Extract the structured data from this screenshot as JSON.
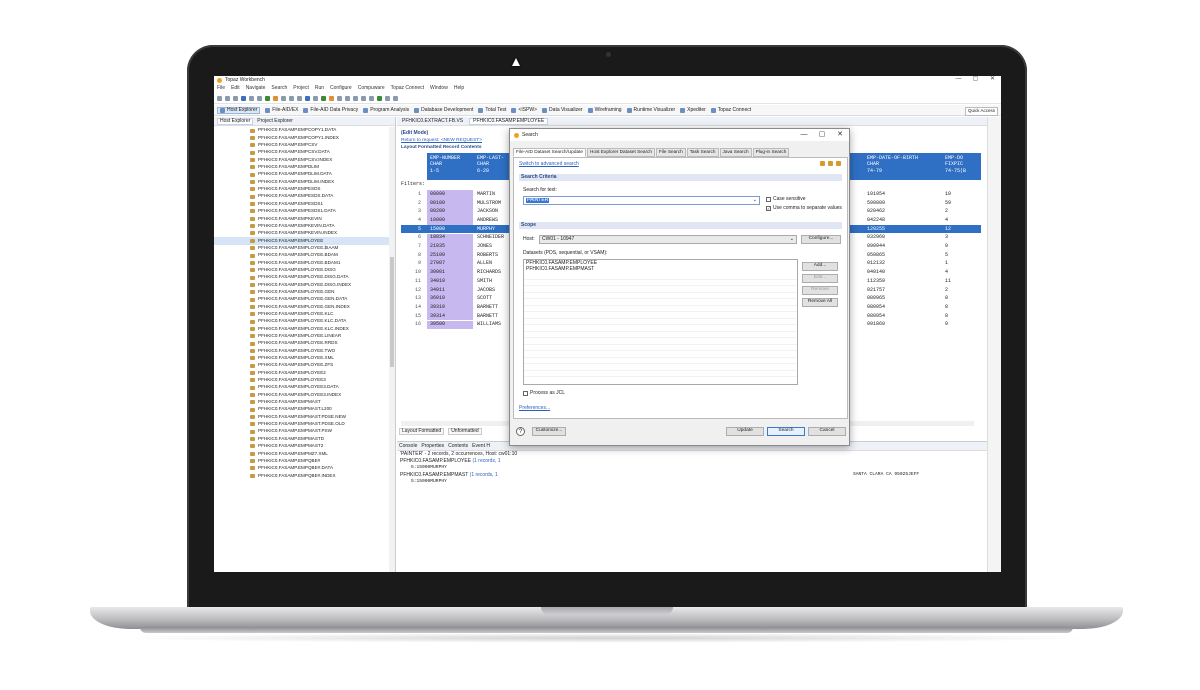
{
  "window": {
    "title": "Topaz Workbench",
    "controls": [
      "—",
      "▢",
      "✕"
    ]
  },
  "menu": [
    "File",
    "Edit",
    "Navigate",
    "Search",
    "Project",
    "Run",
    "Configure",
    "Compuware",
    "Topaz Connect",
    "Window",
    "Help"
  ],
  "perspectives": [
    {
      "label": "Host Explorer",
      "selected": true
    },
    {
      "label": "File-AID/EX",
      "selected": false
    },
    {
      "label": "File-AID Data Privacy",
      "selected": false
    },
    {
      "label": "Program Analysis",
      "selected": false
    },
    {
      "label": "Database Development",
      "selected": false
    },
    {
      "label": "Total Test",
      "selected": false
    },
    {
      "label": "<ISPW>",
      "selected": false
    },
    {
      "label": "Data Visualizer",
      "selected": false
    },
    {
      "label": "Wireframing",
      "selected": false
    },
    {
      "label": "Runtime Visualizer",
      "selected": false
    },
    {
      "label": "Xpediter",
      "selected": false
    },
    {
      "label": "Topaz Connect",
      "selected": false
    }
  ],
  "quick_access": "Quick Access",
  "left_tabs": [
    "Host Explorer",
    "Project Explorer"
  ],
  "tree_items": [
    "PFHKIC0.FASAMP.EMPCOPY1.DATA",
    "PFHKIC0.FASAMP.EMPCOPY1.INDEX",
    "PFHKIC0.FASAMP.EMPCSV",
    "PFHKIC0.FASAMP.EMPCSV.DATA",
    "PFHKIC0.FASAMP.EMPCSV.INDEX",
    "PFHKIC0.FASAMP.EMPDLIM",
    "PFHKIC0.FASAMP.EMPDLIM.DATA",
    "PFHKIC0.FASAMP.EMPDLIM.INDEX",
    "PFHKIC0.FASAMP.EMPESDS",
    "PFHKIC0.FASAMP.EMPESDS.DATA",
    "PFHKIC0.FASAMP.EMPESDS1",
    "PFHKIC0.FASAMP.EMPESDS1.DATA",
    "PFHKIC0.FASAMP.EMPKEVIN",
    "PFHKIC0.FASAMP.EMPKEVIN.DATA",
    "PFHKIC0.FASAMP.EMPKEVIN.INDEX",
    "PFHKIC0.FASAMP.EMPLOYEE",
    "PFHKIC0.FASAMP.EMPLOYEE.$IAAM",
    "PFHKIC0.FASAMP.EMPLOYEE.BDAM",
    "PFHKIC0.FASAMP.EMPLOYEE.BDAM1",
    "PFHKIC0.FASAMP.EMPLOYEE.DISG",
    "PFHKIC0.FASAMP.EMPLOYEE.DISG.DATA",
    "PFHKIC0.FASAMP.EMPLOYEE.DISG.INDEX",
    "PFHKIC0.FASAMP.EMPLOYEE.GEN",
    "PFHKIC0.FASAMP.EMPLOYEE.GEN.DATA",
    "PFHKIC0.FASAMP.EMPLOYEE.GEN.INDEX",
    "PFHKIC0.FASAMP.EMPLOYEE.KLC",
    "PFHKIC0.FASAMP.EMPLOYEE.KLC.DATA",
    "PFHKIC0.FASAMP.EMPLOYEE.KLC.INDEX",
    "PFHKIC0.FASAMP.EMPLOYEE.LINEAR",
    "PFHKIC0.FASAMP.EMPLOYEE.RRDS",
    "PFHKIC0.FASAMP.EMPLOYEE.TWO",
    "PFHKIC0.FASAMP.EMPLOYEE.XML",
    "PFHKIC0.FASAMP.EMPLOYEE.ZFS",
    "PFHKIC0.FASAMP.EMPLOYEE2",
    "PFHKIC0.FASAMP.EMPLOYEE3",
    "PFHKIC0.FASAMP.EMPLOYEE3.DATA",
    "PFHKIC0.FASAMP.EMPLOYEE3.INDEX",
    "PFHKIC0.FASAMP.EMPMAST",
    "PFHKIC0.FASAMP.EMPMAST.L200",
    "PFHKIC0.FASAMP.EMPMAST.PDSE.NEW",
    "PFHKIC0.FASAMP.EMPMAST.PDSE.OLD",
    "PFHKIC0.FASAMP.EMPMAST.PSW",
    "PFHKIC0.FASAMP.EMPMASTD",
    "PFHKIC0.FASAMP.EMPMAST2",
    "PFHKIC0.FASAMP.EMPMZ7.XML",
    "PFHKIC0.FASAMP.EMPQBE#",
    "PFHKIC0.FASAMP.EMPQBE#.DATA",
    "PFHKIC0.FASAMP.EMPQBE#.INDEX"
  ],
  "editor_tabs": [
    "PFHKIC0.EXTRACT.FB.VS",
    "PFHKIC0.FASAMP.EMPLOYEE"
  ],
  "editor": {
    "mode": "(Edit Mode)",
    "return_link": "Return to request: <NEW REQUEST>",
    "layout_header": "Layout Formatted Record Contents",
    "filters_label": "Filters:",
    "col_id": "EMP-NUMBER\nCHAR\n1-5",
    "col_name": "EMP-LAST-\nCHAR\n6-20",
    "col_dob": "EMP-DATE-OF-BIRTH\nCHAR\n74-79",
    "col_x": "EMP-DO\nFIXPIC\n74-75(B",
    "rows": [
      {
        "n": "1",
        "id": "00090",
        "name": "MARTIN",
        "dob": "101954",
        "x": "10"
      },
      {
        "n": "2",
        "id": "00100",
        "name": "MULSTROM",
        "dob": "590809",
        "x": "59"
      },
      {
        "n": "3",
        "id": "00200",
        "name": "JACKSON",
        "dob": "020462",
        "x": "2"
      },
      {
        "n": "4",
        "id": "10000",
        "name": "ANDREWS",
        "dob": "042248",
        "x": "4"
      },
      {
        "n": "5",
        "id": "15000",
        "name": "MURPHY",
        "dob": "120255",
        "x": "12"
      },
      {
        "n": "6",
        "id": "18034",
        "name": "SCHNEIDER",
        "dob": "032960",
        "x": "3"
      },
      {
        "n": "7",
        "id": "21035",
        "name": "JONES",
        "dob": "090944",
        "x": "9"
      },
      {
        "n": "8",
        "id": "25100",
        "name": "ROBERTS",
        "dob": "050865",
        "x": "5"
      },
      {
        "n": "9",
        "id": "27007",
        "name": "ALLEN",
        "dob": "012132",
        "x": "1"
      },
      {
        "n": "10",
        "id": "30001",
        "name": "RICHARDS",
        "dob": "040140",
        "x": "4"
      },
      {
        "n": "11",
        "id": "34010",
        "name": "SMITH",
        "dob": "112359",
        "x": "11"
      },
      {
        "n": "12",
        "id": "34011",
        "name": "JACOBS",
        "dob": "021757",
        "x": "2"
      },
      {
        "n": "13",
        "id": "36010",
        "name": "SCOTT",
        "dob": "080965",
        "x": "8"
      },
      {
        "n": "14",
        "id": "39310",
        "name": "BARNETT",
        "dob": "080954",
        "x": "8"
      },
      {
        "n": "15",
        "id": "39314",
        "name": "BARNETT",
        "dob": "080954",
        "x": "8"
      },
      {
        "n": "16",
        "id": "39500",
        "name": "WILLIAMS",
        "dob": "091860",
        "x": "9"
      }
    ],
    "bottom_tabs": [
      "Layout Formatted",
      "Unformatted"
    ]
  },
  "console": {
    "tabs": [
      "Console",
      "Properties",
      "Contents",
      "Event H"
    ],
    "summary": "'PAINTER' - 2 records, 2 occurrences, Host: cw01:10",
    "results": [
      {
        "label": "PFHKIC0.FASAMP.EMPLOYEE",
        "count": "(1 records, 1"
      },
      {
        "label": "5:15000MURPHY",
        "count": ""
      },
      {
        "label": "PFHKIC0.FASAMP.EMPMAST",
        "count": "(1 records, 1"
      },
      {
        "label": "5:15000MURPHY",
        "count": ""
      }
    ],
    "tail": "SANTA CLARA    CA  95025JEFF"
  },
  "dialog": {
    "title": "Search",
    "tabs": [
      {
        "label": "File-AID Dataset Search/Update",
        "selected": true
      },
      {
        "label": "Host Explorer Dataset Search",
        "selected": false
      },
      {
        "label": "File Search",
        "selected": false
      },
      {
        "label": "Task Search",
        "selected": false
      },
      {
        "label": "Java Search",
        "selected": false
      },
      {
        "label": "Plug-in Search",
        "selected": false
      }
    ],
    "advanced_link": "Switch to advanced search",
    "criteria_header": "Search Criteria",
    "search_label": "Search for text:",
    "search_value": "PAINTER",
    "case_sensitive": "Case sensitive",
    "use_comma": "Use comma to separate values",
    "scope_header": "Scope",
    "host_label": "Host:",
    "host_value": "CW01 - 10947",
    "configure": "Configure...",
    "datasets_label": "Datasets (PDS, sequential, or VSAM):",
    "datasets": [
      "PFHKIC0.FASAMP.EMPLOYEE",
      "PFHKIC0.FASAMP.EMPMAST"
    ],
    "add": "Add...",
    "edit": "Edit...",
    "remove": "Remove",
    "remove_all": "Remove All",
    "process_jcl": "Process as JCL",
    "preferences": "Preferences...",
    "customize": "Customize...",
    "update": "Update",
    "search": "Search",
    "cancel": "Cancel"
  }
}
